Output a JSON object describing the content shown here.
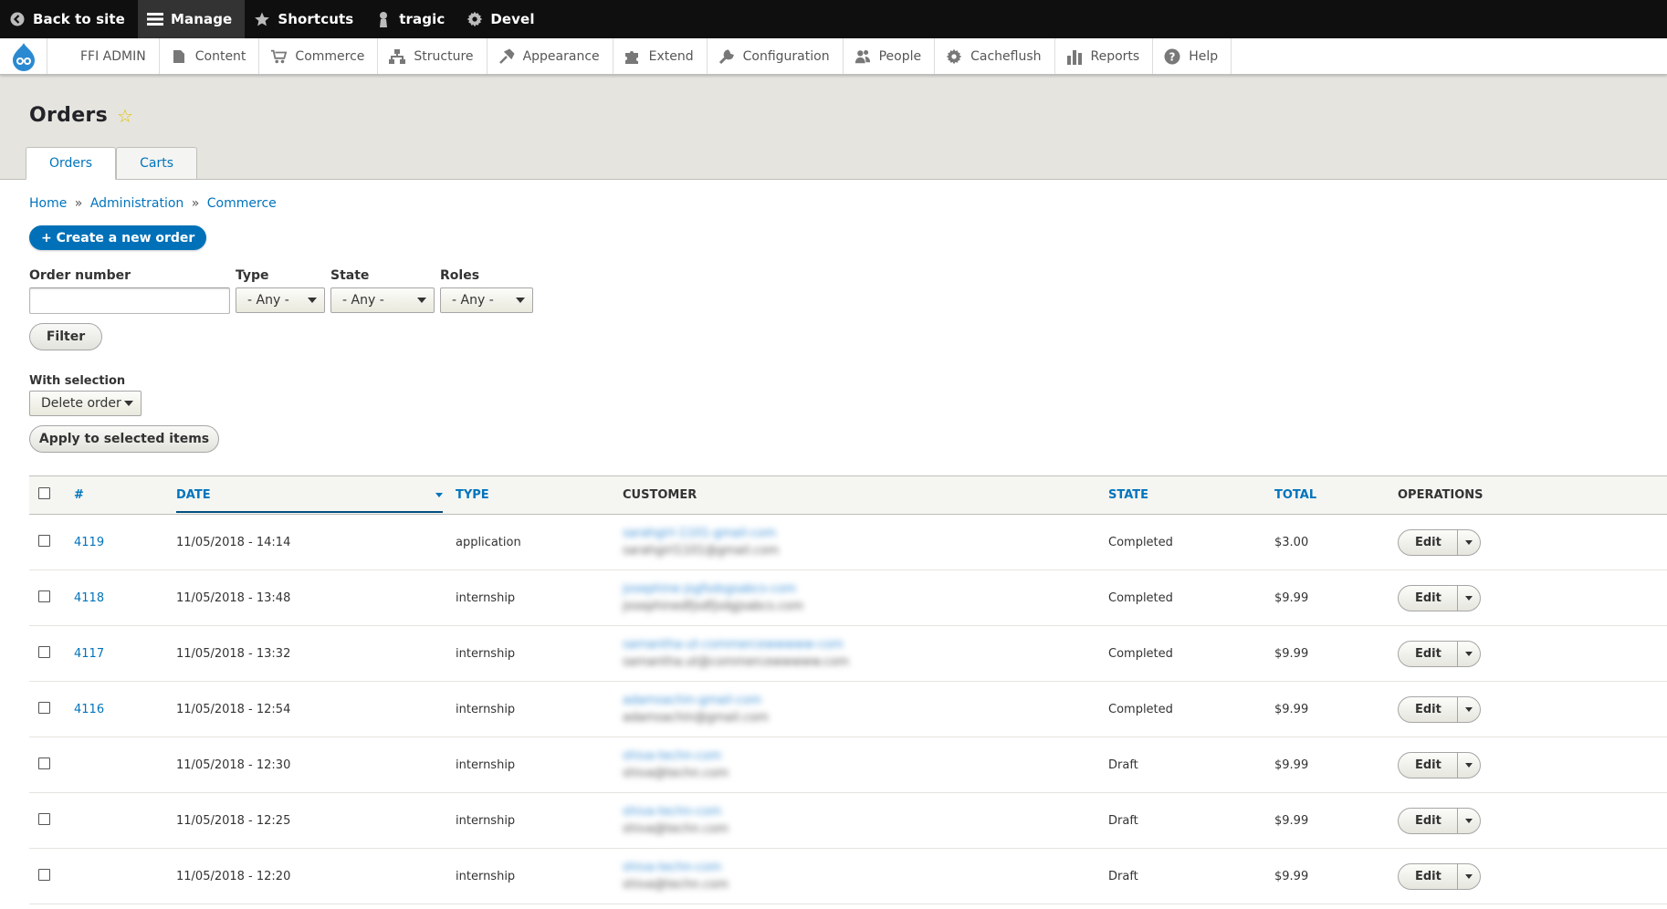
{
  "toolbar": {
    "back": "Back to site",
    "manage": "Manage",
    "shortcuts": "Shortcuts",
    "user": "tragic",
    "devel": "Devel"
  },
  "menu": {
    "site": "FFI ADMIN",
    "items": [
      "Content",
      "Commerce",
      "Structure",
      "Appearance",
      "Extend",
      "Configuration",
      "People",
      "Cacheflush",
      "Reports",
      "Help"
    ]
  },
  "page": {
    "title": "Orders",
    "tabs": [
      "Orders",
      "Carts"
    ]
  },
  "breadcrumb": [
    "Home",
    "Administration",
    "Commerce"
  ],
  "breadcrumb_sep": "»",
  "create_button": "+ Create a new order",
  "filters": {
    "order_number_label": "Order number",
    "order_number_value": "",
    "type_label": "Type",
    "type_value": "- Any -",
    "state_label": "State",
    "state_value": "- Any -",
    "roles_label": "Roles",
    "roles_value": "- Any -",
    "filter_button": "Filter"
  },
  "bulk": {
    "label": "With selection",
    "action_value": "Delete order",
    "apply_button": "Apply to selected items"
  },
  "table": {
    "columns": [
      "#",
      "DATE",
      "TYPE",
      "CUSTOMER",
      "STATE",
      "TOTAL",
      "OPERATIONS"
    ],
    "edit_label": "Edit",
    "rows": [
      {
        "id": "4119",
        "date": "11/05/2018 - 14:14",
        "type": "application",
        "customer_link": "sarahgirl-1101-gmail-com",
        "customer_email": "sarahgirl1101@gmail.com",
        "state": "Completed",
        "total": "$3.00"
      },
      {
        "id": "4118",
        "date": "11/05/2018 - 13:48",
        "type": "internship",
        "customer_link": "josephine-jsgfsdsgsabcs-com",
        "customer_email": "josephinedfjsdfjsdgjsabcs.com",
        "state": "Completed",
        "total": "$9.99"
      },
      {
        "id": "4117",
        "date": "11/05/2018 - 13:32",
        "type": "internship",
        "customer_link": "samantha-ut-commercewwwww-com",
        "customer_email": "samantha.ut@commercewwwww.com",
        "state": "Completed",
        "total": "$9.99"
      },
      {
        "id": "4116",
        "date": "11/05/2018 - 12:54",
        "type": "internship",
        "customer_link": "adamsachin-gmail-com",
        "customer_email": "adamsachin@gmail.com",
        "state": "Completed",
        "total": "$9.99"
      },
      {
        "id": "",
        "date": "11/05/2018 - 12:30",
        "type": "internship",
        "customer_link": "shiva-techn-com",
        "customer_email": "shiva@techn.com",
        "state": "Draft",
        "total": "$9.99"
      },
      {
        "id": "",
        "date": "11/05/2018 - 12:25",
        "type": "internship",
        "customer_link": "shiva-techn-com",
        "customer_email": "shiva@techn.com",
        "state": "Draft",
        "total": "$9.99"
      },
      {
        "id": "",
        "date": "11/05/2018 - 12:20",
        "type": "internship",
        "customer_link": "shiva-techn-com",
        "customer_email": "shiva@techn.com",
        "state": "Draft",
        "total": "$9.99"
      }
    ]
  }
}
